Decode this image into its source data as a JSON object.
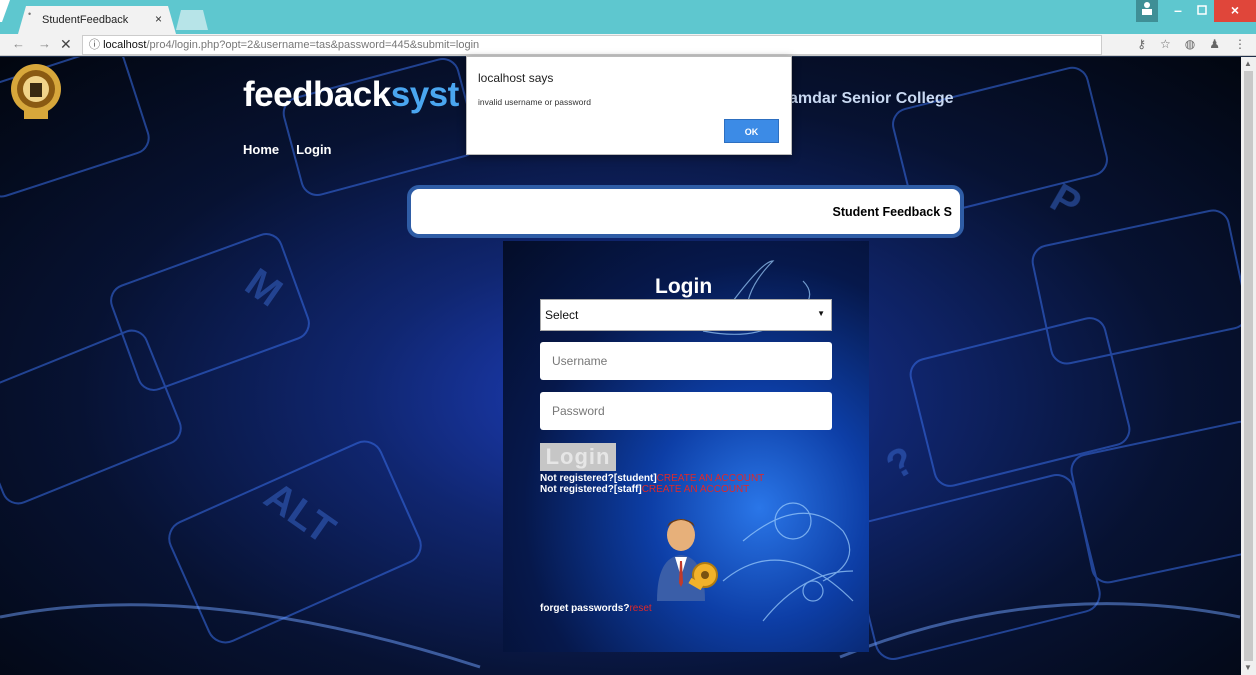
{
  "browser": {
    "tab_title": "StudentFeedback",
    "tab_close": "×",
    "url_host": "localhost",
    "url_path": "/pro4/login.php?opt=2&username=tas&password=445&submit=login"
  },
  "site": {
    "brand_white": "feedback",
    "brand_blue": "syst",
    "college": "amdar Senior College",
    "menu": [
      "Home",
      "Login"
    ],
    "marquee": "Student Feedback S"
  },
  "login": {
    "title": "Login",
    "select_value": "Select",
    "username_placeholder": "Username",
    "password_placeholder": "Password",
    "button": "Login",
    "reg_student_text": "Not registered?[student]",
    "reg_staff_text": "Not registered?[staff]",
    "create_account": "CREATE AN ACCOUNT",
    "forget_text": "forget passwords?",
    "reset_link": "reset"
  },
  "alert": {
    "heading": "localhost says",
    "message": "invalid username or password",
    "ok": "OK"
  },
  "colors": {
    "tabbar": "#5ec7cf",
    "brand_blue": "#4aa6f0",
    "link_red": "#e02828",
    "ok_button": "#3c8be6"
  }
}
